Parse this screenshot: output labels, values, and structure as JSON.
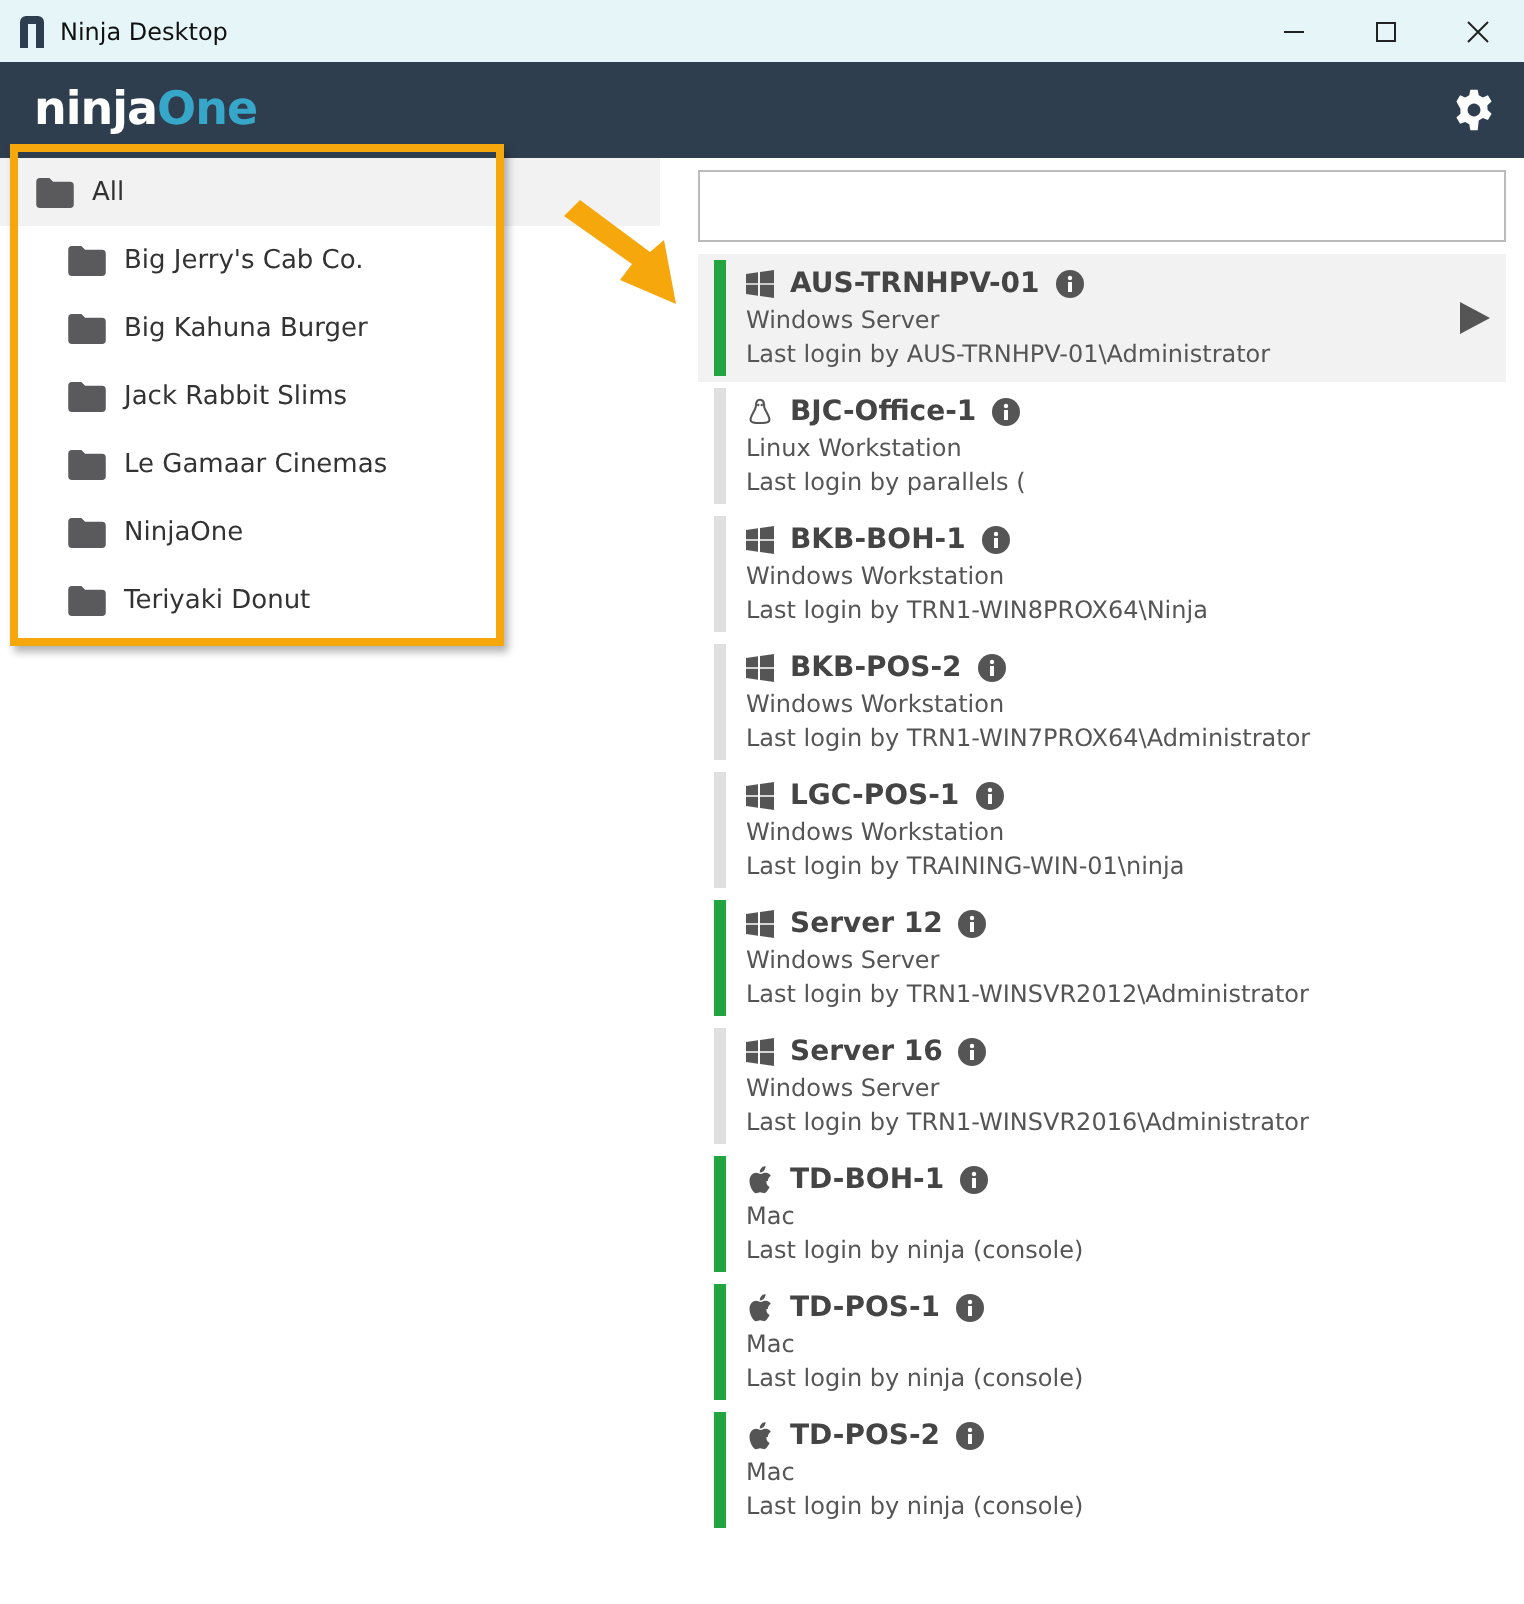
{
  "window": {
    "title": "Ninja Desktop"
  },
  "header": {
    "logo_left": "ninja",
    "logo_right": "One"
  },
  "sidebar": {
    "items": [
      {
        "label": "All",
        "selected": true,
        "children": [
          {
            "label": "Big Jerry's Cab Co.",
            "selected": false
          },
          {
            "label": "Big Kahuna Burger",
            "selected": false
          },
          {
            "label": "Jack Rabbit Slims",
            "selected": false
          },
          {
            "label": "Le Gamaar Cinemas",
            "selected": false
          },
          {
            "label": "NinjaOne",
            "selected": false
          },
          {
            "label": "Teriyaki Donut",
            "selected": false
          }
        ]
      }
    ]
  },
  "devices": [
    {
      "name": "AUS-TRNHPV-01",
      "kind": "windows",
      "type": "Windows Server",
      "login": "Last login by AUS-TRNHPV-01\\Administrator",
      "online": true,
      "selected": true
    },
    {
      "name": "BJC-Office-1",
      "kind": "linux",
      "type": "Linux Workstation",
      "login": "Last login by parallels (",
      "online": false,
      "selected": false
    },
    {
      "name": "BKB-BOH-1",
      "kind": "windows",
      "type": "Windows Workstation",
      "login": "Last login by TRN1-WIN8PROX64\\Ninja",
      "online": false,
      "selected": false
    },
    {
      "name": "BKB-POS-2",
      "kind": "windows",
      "type": "Windows Workstation",
      "login": "Last login by TRN1-WIN7PROX64\\Administrator",
      "online": false,
      "selected": false
    },
    {
      "name": "LGC-POS-1",
      "kind": "windows",
      "type": "Windows Workstation",
      "login": "Last login by TRAINING-WIN-01\\ninja",
      "online": false,
      "selected": false
    },
    {
      "name": "Server 12",
      "kind": "windows",
      "type": "Windows Server",
      "login": "Last login by TRN1-WINSVR2012\\Administrator",
      "online": true,
      "selected": false
    },
    {
      "name": "Server 16",
      "kind": "windows",
      "type": "Windows Server",
      "login": "Last login by TRN1-WINSVR2016\\Administrator",
      "online": false,
      "selected": false
    },
    {
      "name": "TD-BOH-1",
      "kind": "mac",
      "type": "Mac",
      "login": "Last login by ninja (console)",
      "online": true,
      "selected": false
    },
    {
      "name": "TD-POS-1",
      "kind": "mac",
      "type": "Mac",
      "login": "Last login by ninja (console)",
      "online": true,
      "selected": false
    },
    {
      "name": "TD-POS-2",
      "kind": "mac",
      "type": "Mac",
      "login": "Last login by ninja (console)",
      "online": true,
      "selected": false
    }
  ]
}
